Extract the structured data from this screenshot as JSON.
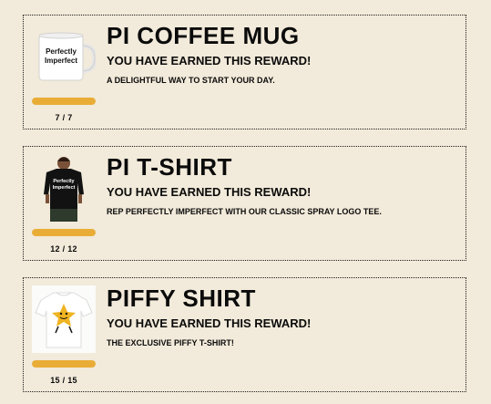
{
  "colors": {
    "background": "#f2eada",
    "progress": "#e9ad37",
    "text": "#0b0b0b"
  },
  "rewards": [
    {
      "title": "PI COFFEE MUG",
      "status": "YOU HAVE EARNED THIS REWARD!",
      "description": "A DELIGHTFUL WAY TO START YOUR DAY.",
      "progress_text": "7 / 7",
      "progress": 1.0,
      "image_text": [
        "Perfectly",
        "Imperfect"
      ],
      "icon": "mug-image"
    },
    {
      "title": "PI T-SHIRT",
      "status": "YOU HAVE EARNED THIS REWARD!",
      "description": "REP PERFECTLY IMPERFECT WITH OUR CLASSIC SPRAY LOGO TEE.",
      "progress_text": "12 / 12",
      "progress": 1.0,
      "image_text": [
        "Perfectly",
        "Imperfect"
      ],
      "icon": "tshirt-image"
    },
    {
      "title": "PIFFY SHIRT",
      "status": "YOU HAVE EARNED THIS REWARD!",
      "description": "THE EXCLUSIVE PIFFY T-SHIRT!",
      "progress_text": "15 / 15",
      "progress": 1.0,
      "icon": "piffy-shirt-image"
    }
  ]
}
